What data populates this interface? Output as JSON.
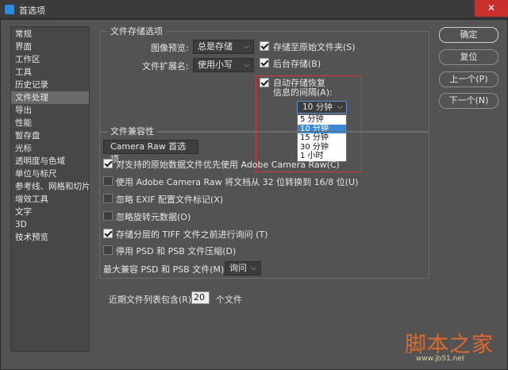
{
  "window": {
    "title": "首选项",
    "close_glyph": "✕"
  },
  "sidebar": {
    "items": [
      {
        "label": "常规"
      },
      {
        "label": "界面"
      },
      {
        "label": "工作区"
      },
      {
        "label": "工具"
      },
      {
        "label": "历史记录"
      },
      {
        "label": "文件处理",
        "active": true
      },
      {
        "label": "导出"
      },
      {
        "label": "性能"
      },
      {
        "label": "暂存盘"
      },
      {
        "label": "光标"
      },
      {
        "label": "透明度与色域"
      },
      {
        "label": "单位与标尺"
      },
      {
        "label": "参考线、网格和切片"
      },
      {
        "label": "增效工具"
      },
      {
        "label": "文字"
      },
      {
        "label": "3D"
      },
      {
        "label": "技术预览"
      }
    ]
  },
  "file_save": {
    "group_title": "文件存储选项",
    "image_preview_label": "图像预览:",
    "image_preview_value": "总是存储",
    "extension_label": "文件扩展名:",
    "extension_value": "使用小写",
    "save_to_original_label": "存储至原始文件夹(S)",
    "save_to_original_checked": true,
    "background_save_label": "后台存储(B)",
    "background_save_checked": true,
    "autosave_label_line1": "自动存储恢复",
    "autosave_label_line2": "信息的间隔(A):",
    "autosave_checked": true,
    "autosave_interval": "10 分钟",
    "autosave_options": [
      "5 分钟",
      "10 分钟",
      "15 分钟",
      "30 分钟",
      "1 小时"
    ],
    "autosave_highlighted": "10 分钟"
  },
  "compat": {
    "group_title": "文件兼容性",
    "camera_raw_button": "Camera Raw 首选项...",
    "options": [
      {
        "label": "对支持的原始数据文件优先使用 Adobe Camera Raw(C)",
        "checked": true
      },
      {
        "label": "使用 Adobe Camera Raw 将文档从 32 位转换到 16/8 位(U)",
        "checked": false
      },
      {
        "label": "忽略 EXIF 配置文件标记(X)",
        "checked": false
      },
      {
        "label": "忽略旋转元数据(O)",
        "checked": false
      },
      {
        "label": "存储分层的 TIFF 文件之前进行询问 (T)",
        "checked": true
      },
      {
        "label": "停用 PSD 和 PSB 文件压缩(D)",
        "checked": false
      }
    ],
    "max_compat_label": "最大兼容 PSD 和 PSB 文件(M):",
    "max_compat_value": "询问"
  },
  "recent": {
    "label": "近期文件列表包含(R):",
    "value": "20",
    "unit": "个文件"
  },
  "buttons": {
    "ok": "确定",
    "reset": "复位",
    "prev": "上一个(P)",
    "next": "下一个(N)"
  },
  "watermark": {
    "main": "脚本之家",
    "url": "www.jb51.net"
  },
  "colors": {
    "accent_red": "#d9353a",
    "highlight_blue": "#3d89d6",
    "panel": "#535353",
    "close_red": "#c9302c"
  }
}
